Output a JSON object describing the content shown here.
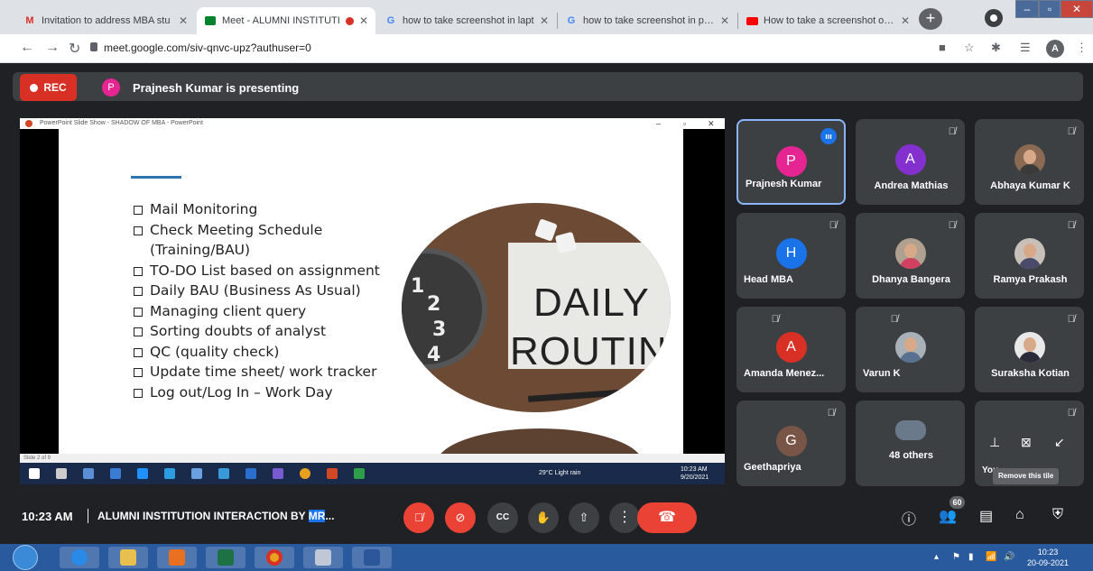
{
  "browser": {
    "tabs": [
      {
        "label": "Invitation to address MBA stu",
        "icon": "gmail-icon",
        "active": false
      },
      {
        "label": "Meet - ALUMNI INSTITUTI",
        "icon": "meet-icon",
        "active": true
      },
      {
        "label": "how to take screenshot in lapt",
        "icon": "google-icon",
        "active": false
      },
      {
        "label": "how to take screenshot in pc -",
        "icon": "google-icon",
        "active": false
      },
      {
        "label": "How to take a screenshot on a",
        "icon": "youtube-icon",
        "active": false
      }
    ],
    "url": "meet.google.com/siv-qnvc-upz?authuser=0",
    "profile_initial": "A"
  },
  "banner": {
    "rec_label": "REC",
    "presenter_initial": "P",
    "presenting_text": "Prajnesh Kumar is presenting"
  },
  "presentation": {
    "window_title": "PowerPoint Slide Show - SHADOW OF MBA - PowerPoint",
    "bullets": [
      "Mail Monitoring",
      "Check Meeting Schedule",
      "(Training/BAU)",
      "TO-DO List based on assignment",
      "Daily BAU (Business As Usual)",
      "Managing client query",
      "Sorting doubts of analyst",
      "QC (quality check)",
      "Update time sheet/ work tracker",
      "Log out/Log In – Work Day"
    ],
    "image_text_1": "DAILY",
    "image_text_2": "ROUTIN",
    "status_text": "Slide 2 of 9",
    "inner_weather": "29°C Light rain",
    "inner_time": "10:23 AM",
    "inner_date": "9/20/2021"
  },
  "participants": [
    {
      "name": "Prajnesh Kumar",
      "initial": "P",
      "color": "#e52592",
      "speaking": true,
      "type": "initial"
    },
    {
      "name": "Andrea Mathias",
      "initial": "A",
      "color": "#8430ce",
      "type": "initial"
    },
    {
      "name": "Abhaya Kumar K",
      "type": "photo"
    },
    {
      "name": "Head MBA",
      "initial": "H",
      "color": "#1a73e8",
      "type": "initial"
    },
    {
      "name": "Dhanya Bangera",
      "type": "photo"
    },
    {
      "name": "Ramya Prakash",
      "type": "photo"
    },
    {
      "name": "Amanda Menez...",
      "initial": "A",
      "color": "#d93025",
      "type": "initial"
    },
    {
      "name": "Varun K",
      "type": "photo"
    },
    {
      "name": "Suraksha Kotian",
      "type": "photo"
    },
    {
      "name": "Geethapriya",
      "initial": "G",
      "color": "#795548",
      "type": "initial"
    },
    {
      "name": "48 others",
      "type": "group"
    },
    {
      "name": "You",
      "type": "self"
    }
  ],
  "you_tooltip": "Remove this tile",
  "meeting": {
    "time": "10:23 AM",
    "title_prefix": "ALUMNI INSTITUTION INTERACTION BY ",
    "title_highlight": "MR",
    "title_suffix": "...",
    "people_count": "60"
  },
  "taskbar": {
    "time": "10:23",
    "date": "20-09-2021"
  }
}
